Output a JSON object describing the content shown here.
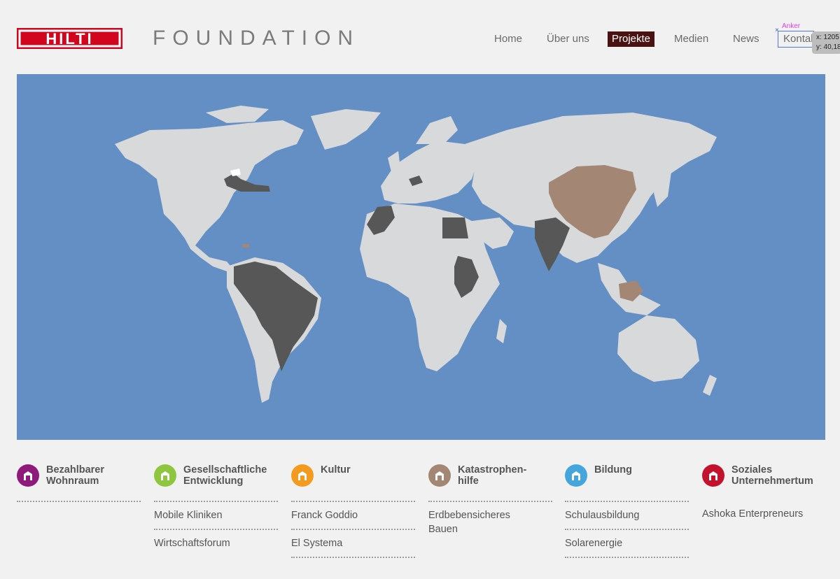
{
  "header": {
    "logo_text": "HILTI",
    "foundation_title": "FOUNDATION",
    "nav": [
      {
        "label": "Home",
        "active": false
      },
      {
        "label": "Über uns",
        "active": false
      },
      {
        "label": "Projekte",
        "active": true
      },
      {
        "label": "Medien",
        "active": false
      },
      {
        "label": "News",
        "active": false
      },
      {
        "label": "Kontakt",
        "active": false
      }
    ],
    "overlay": {
      "anchor_label": "Anker",
      "coord_x": "x: 1205",
      "coord_y": "y: 40,18"
    }
  },
  "map": {
    "colors": {
      "ocean": "#638fc5",
      "land": "#d8d9db",
      "project_dark": "#575757",
      "project_brown": "#a38673",
      "highlight_white": "#ffffff"
    }
  },
  "categories": [
    {
      "title_line1": "Bezahlbarer",
      "title_line2": "Wohnraum",
      "color": "#8e1a7c",
      "items": []
    },
    {
      "title_line1": "Gesellschaftliche",
      "title_line2": "Entwicklung",
      "color": "#8ec63f",
      "items": [
        "Mobile Kliniken",
        "Wirtschaftsforum"
      ]
    },
    {
      "title_line1": "Kultur",
      "title_line2": "",
      "color": "#f39a1f",
      "items": [
        "Franck Goddio",
        "El Systema"
      ]
    },
    {
      "title_line1": "Katastrophen-",
      "title_line2": "hilfe",
      "color": "#a38673",
      "items": [
        "Erdbebensicheres Bauen"
      ]
    },
    {
      "title_line1": "Bildung",
      "title_line2": "",
      "color": "#45a6dd",
      "items": [
        "Schulausbildung",
        "Solarenergie"
      ]
    },
    {
      "title_line1": "Soziales",
      "title_line2": "Unternehmertum",
      "color": "#c4122e",
      "items": [
        "Ashoka Enterpreneurs"
      ]
    }
  ]
}
